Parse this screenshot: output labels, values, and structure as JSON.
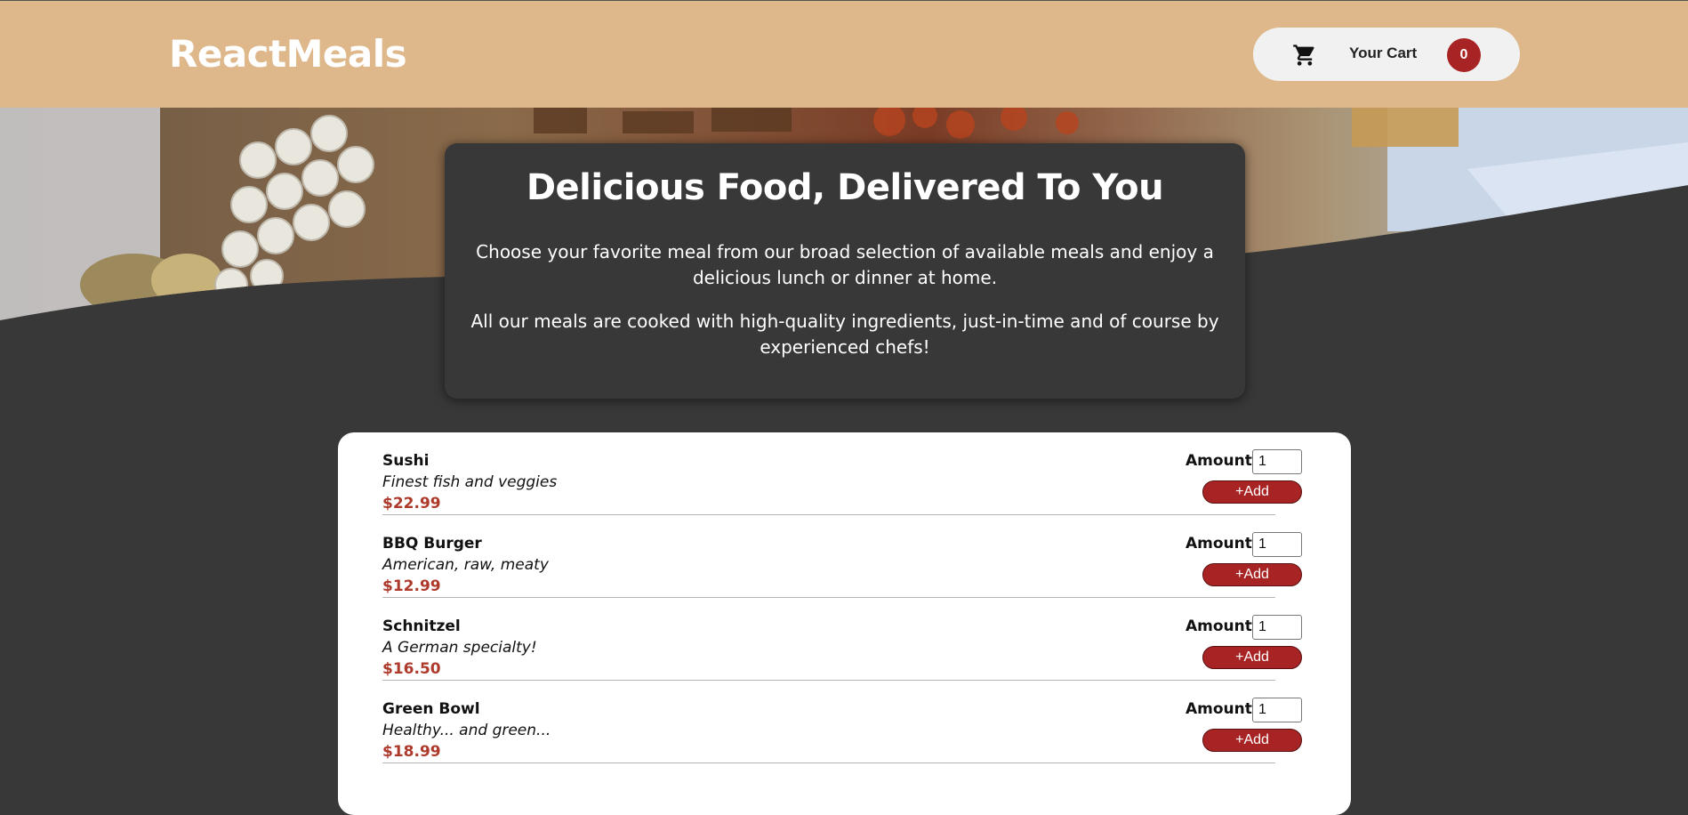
{
  "header": {
    "brand": "ReactMeals",
    "cart": {
      "label": "Your Cart",
      "count": "0",
      "icon": "cart-icon"
    }
  },
  "summary": {
    "title": "Delicious Food, Delivered To You",
    "paragraph1": "Choose your favorite meal from our broad selection of available meals and enjoy a delicious lunch or dinner at home.",
    "paragraph2": "All our meals are cooked with high-quality ingredients, just-in-time and of course by experienced chefs!"
  },
  "meals": {
    "amount_label": "Amount",
    "add_label": "+Add",
    "items": [
      {
        "name": "Sushi",
        "description": "Finest fish and veggies",
        "price": "$22.99",
        "amount": "1"
      },
      {
        "name": "BBQ Burger",
        "description": "American, raw, meaty",
        "price": "$12.99",
        "amount": "1"
      },
      {
        "name": "Schnitzel",
        "description": "A German specialty!",
        "price": "$16.50",
        "amount": "1"
      },
      {
        "name": "Green Bowl",
        "description": "Healthy... and green...",
        "price": "$18.99",
        "amount": "1"
      }
    ]
  },
  "colors": {
    "header_bg": "#deb88b",
    "page_bg": "#383838",
    "accent": "#a82424",
    "price": "#ad3a2b"
  }
}
